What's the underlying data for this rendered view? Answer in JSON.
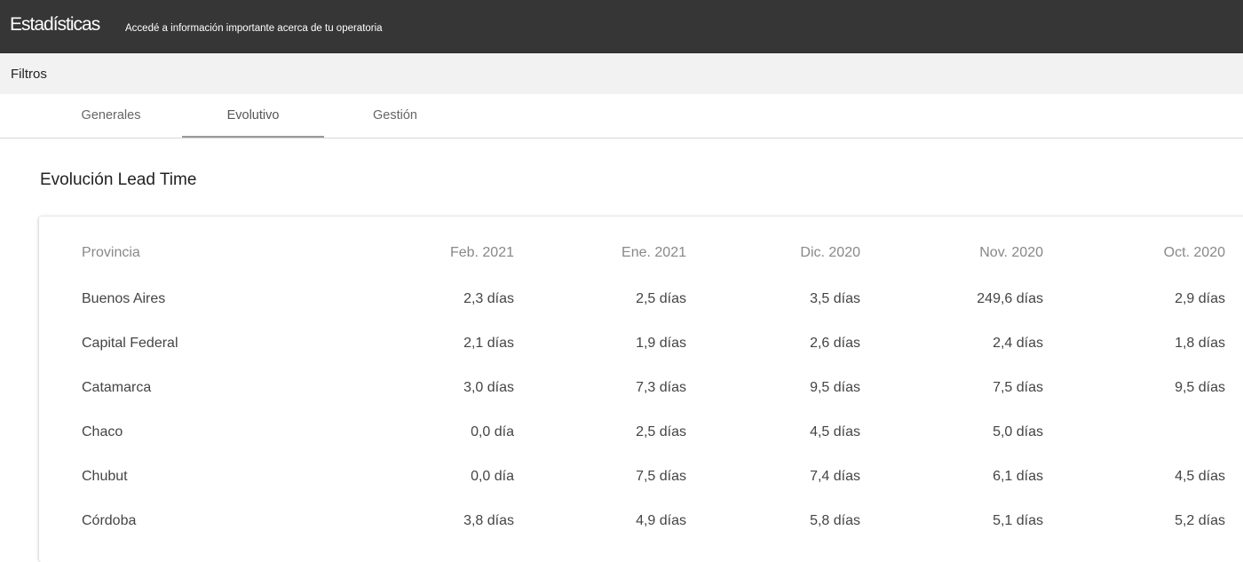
{
  "header": {
    "title": "Estadísticas",
    "subtitle": "Accedé a información importante acerca de tu operatoria"
  },
  "filters": {
    "label": "Filtros"
  },
  "tabs": [
    {
      "label": "Generales",
      "active": false
    },
    {
      "label": "Evolutivo",
      "active": true
    },
    {
      "label": "Gestión",
      "active": false
    }
  ],
  "section": {
    "title": "Evolución Lead Time"
  },
  "table": {
    "columns": [
      "Provincia",
      "Feb. 2021",
      "Ene. 2021",
      "Dic. 2020",
      "Nov. 2020",
      "Oct. 2020"
    ],
    "rows": [
      [
        "Buenos Aires",
        "2,3 días",
        "2,5 días",
        "3,5 días",
        "249,6 días",
        "2,9 días"
      ],
      [
        "Capital Federal",
        "2,1 días",
        "1,9 días",
        "2,6 días",
        "2,4 días",
        "1,8 días"
      ],
      [
        "Catamarca",
        "3,0 días",
        "7,3 días",
        "9,5 días",
        "7,5 días",
        "9,5 días"
      ],
      [
        "Chaco",
        "0,0 día",
        "2,5 días",
        "4,5 días",
        "5,0 días",
        ""
      ],
      [
        "Chubut",
        "0,0 día",
        "7,5 días",
        "7,4 días",
        "6,1 días",
        "4,5 días"
      ],
      [
        "Córdoba",
        "3,8 días",
        "4,9 días",
        "5,8 días",
        "5,1 días",
        "5,2 días"
      ]
    ]
  }
}
